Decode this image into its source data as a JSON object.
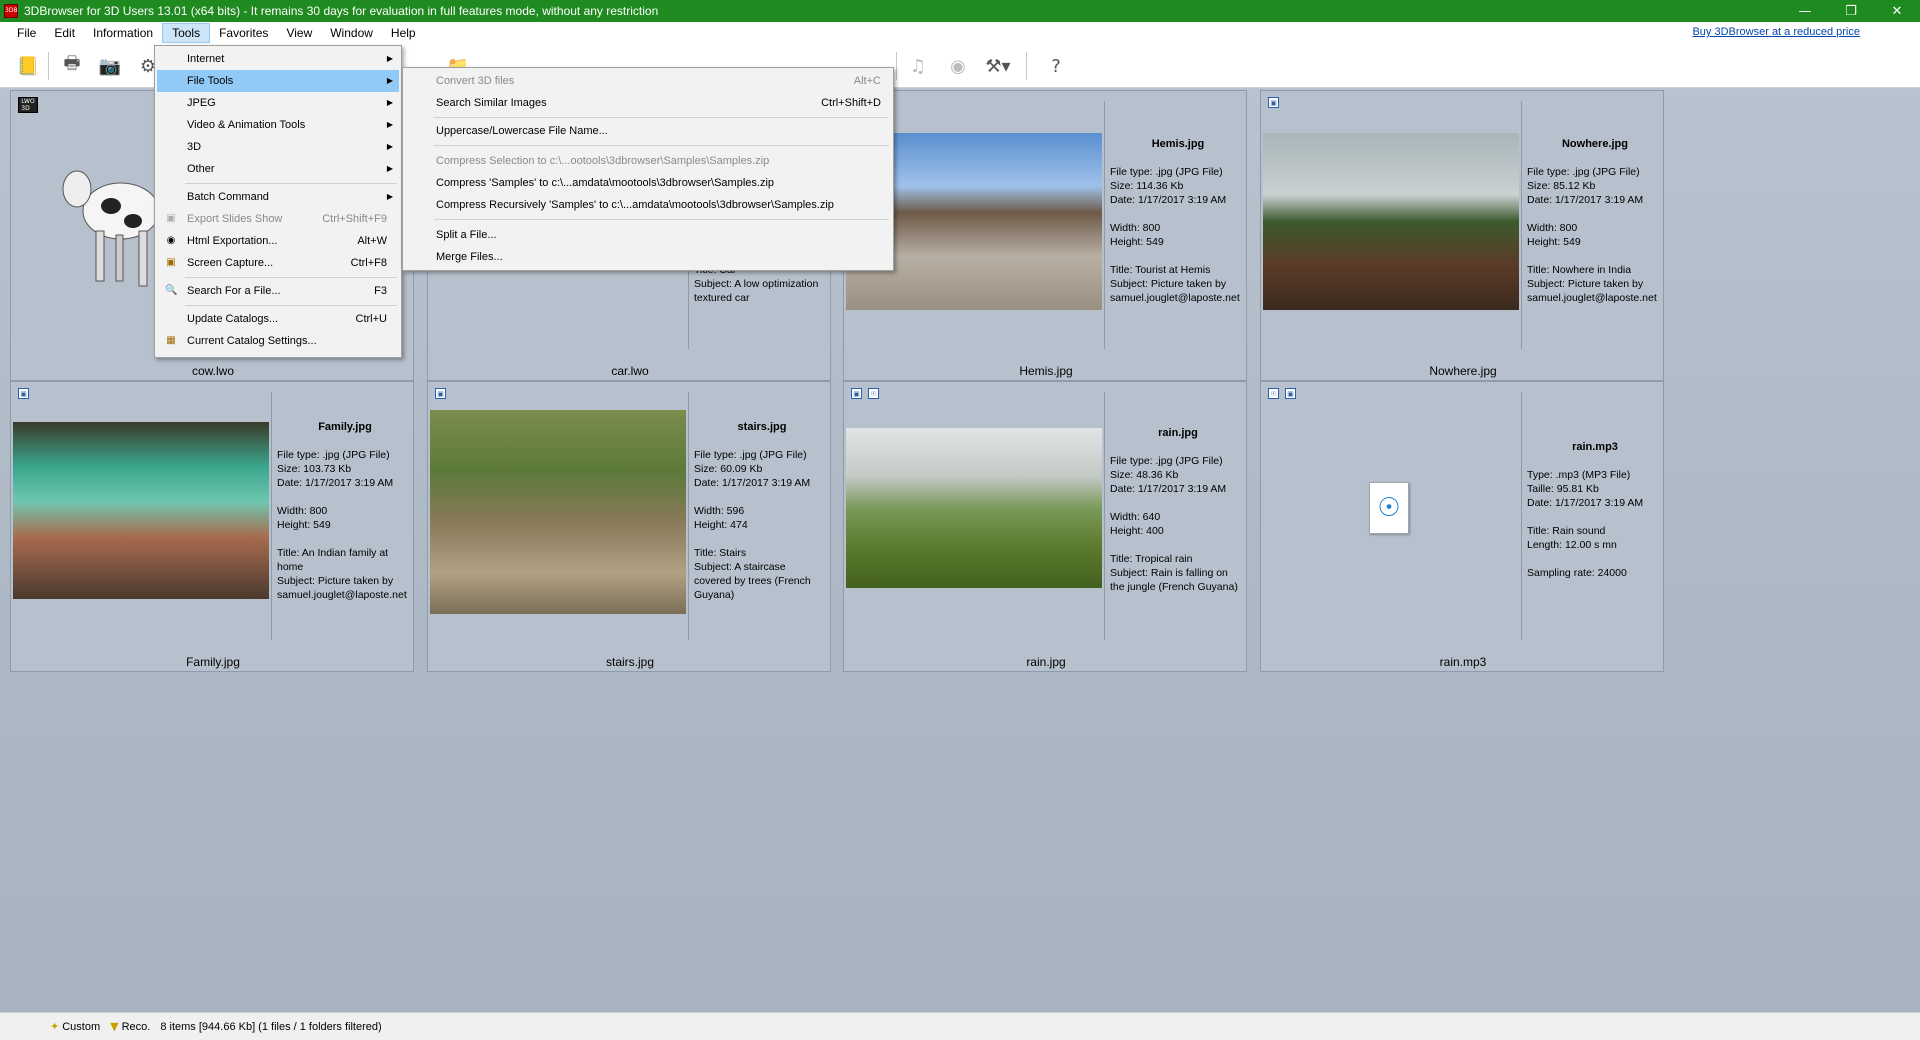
{
  "window": {
    "title": "3DBrowser for 3D Users 13.01 (x64 bits) - It remains 30 days for evaluation in full features mode, without any restriction",
    "app_icon_text": "3DB",
    "title_bar_color": "#1f8a1f"
  },
  "menubar": {
    "items": [
      "File",
      "Edit",
      "Information",
      "Tools",
      "Favorites",
      "View",
      "Window",
      "Help"
    ],
    "active": "Tools",
    "buy_link": "Buy 3DBrowser at a reduced price"
  },
  "tools_menu": {
    "items": [
      {
        "label": "Internet",
        "submenu": true
      },
      {
        "label": "File Tools",
        "submenu": true,
        "highlighted": true
      },
      {
        "label": "JPEG",
        "submenu": true
      },
      {
        "label": "Video & Animation Tools",
        "submenu": true
      },
      {
        "label": "3D",
        "submenu": true
      },
      {
        "label": "Other",
        "submenu": true
      },
      {
        "label": "Batch Command",
        "submenu": true
      },
      {
        "label": "Export Slides Show",
        "shortcut": "Ctrl+Shift+F9",
        "disabled": true
      },
      {
        "label": "Html Exportation...",
        "shortcut": "Alt+W",
        "icon": "globe-icon"
      },
      {
        "label": "Screen Capture...",
        "shortcut": "Ctrl+F8",
        "icon": "camera-icon"
      },
      {
        "label": "Search For a File...",
        "shortcut": "F3",
        "icon": "magnifier-icon"
      },
      {
        "label": "Update Catalogs...",
        "shortcut": "Ctrl+U"
      },
      {
        "label": "Current Catalog Settings...",
        "icon": "catalog-icon"
      }
    ]
  },
  "file_tools_menu": {
    "items": [
      {
        "label": "Convert 3D files",
        "shortcut": "Alt+C",
        "disabled": true
      },
      {
        "label": "Search Similar Images",
        "shortcut": "Ctrl+Shift+D"
      },
      {
        "label": "Uppercase/Lowercase File Name..."
      },
      {
        "label": "Compress Selection to c:\\...ootools\\3dbrowser\\Samples\\Samples.zip",
        "disabled": true
      },
      {
        "label": "Compress 'Samples' to c:\\...amdata\\mootools\\3dbrowser\\Samples.zip"
      },
      {
        "label": "Compress Recursively 'Samples' to c:\\...amdata\\mootools\\3dbrowser\\Samples.zip"
      },
      {
        "label": "Split a File..."
      },
      {
        "label": "Merge Files..."
      }
    ]
  },
  "cards": {
    "cow": {
      "caption": "cow.lwo"
    },
    "car": {
      "caption": "car.lwo",
      "info_lines": [
        "Title: Car",
        "Subject: A low optimization",
        "textured car"
      ]
    },
    "hemis": {
      "filename": "Hemis.jpg",
      "caption": "Hemis.jpg",
      "type": "File type: .jpg (JPG File)",
      "size": "Size: 114.36 Kb",
      "date": "Date: 1/17/2017 3:19 AM",
      "width": "Width: 800",
      "height": "Height: 549",
      "title": "Title: Tourist at Hemis",
      "subject": "Subject: Picture taken by",
      "subject2": "samuel.jouglet@laposte.net"
    },
    "nowhere": {
      "filename": "Nowhere.jpg",
      "caption": "Nowhere.jpg",
      "type": "File type: .jpg (JPG File)",
      "size": "Size: 85.12 Kb",
      "date": "Date: 1/17/2017 3:19 AM",
      "width": "Width: 800",
      "height": "Height: 549",
      "title": "Title: Nowhere in India",
      "subject": "Subject: Picture taken by",
      "subject2": "samuel.jouglet@laposte.net"
    },
    "family": {
      "filename": "Family.jpg",
      "caption": "Family.jpg",
      "type": "File type: .jpg (JPG File)",
      "size": "Size: 103.73 Kb",
      "date": "Date: 1/17/2017 3:19 AM",
      "width": "Width: 800",
      "height": "Height: 549",
      "title": "Title: An Indian family at",
      "title2": "home",
      "subject": "Subject: Picture taken by",
      "subject2": "samuel.jouglet@laposte.net"
    },
    "stairs": {
      "filename": "stairs.jpg",
      "caption": "stairs.jpg",
      "type": "File type: .jpg (JPG File)",
      "size": "Size: 60.09 Kb",
      "date": "Date: 1/17/2017 3:19 AM",
      "width": "Width: 596",
      "height": "Height: 474",
      "title": "Title: Stairs",
      "subject": "Subject: A staircase",
      "subject2": "covered by trees (French",
      "subject3": "Guyana)"
    },
    "rain": {
      "filename": "rain.jpg",
      "caption": "rain.jpg",
      "type": "File type: .jpg (JPG File)",
      "size": "Size: 48.36 Kb",
      "date": "Date: 1/17/2017 3:19 AM",
      "width": "Width: 640",
      "height": "Height: 400",
      "title": "Title: Tropical rain",
      "subject": "Subject: Rain is falling on",
      "subject2": "the jungle (French Guyana)"
    },
    "rainmp3": {
      "filename": "rain.mp3",
      "caption": "rain.mp3",
      "type": "Type: .mp3 (MP3 File)",
      "size": "Taille: 95.81 Kb",
      "date": "Date: 1/17/2017 3:19 AM",
      "title": "Title: Rain sound",
      "length": "Length: 12.00 s mn",
      "sampling": "Sampling rate: 24000"
    }
  },
  "statusbar": {
    "custom": "Custom",
    "reco": "Reco.",
    "summary": "8 items [944.66 Kb] (1 files / 1 folders filtered)"
  }
}
